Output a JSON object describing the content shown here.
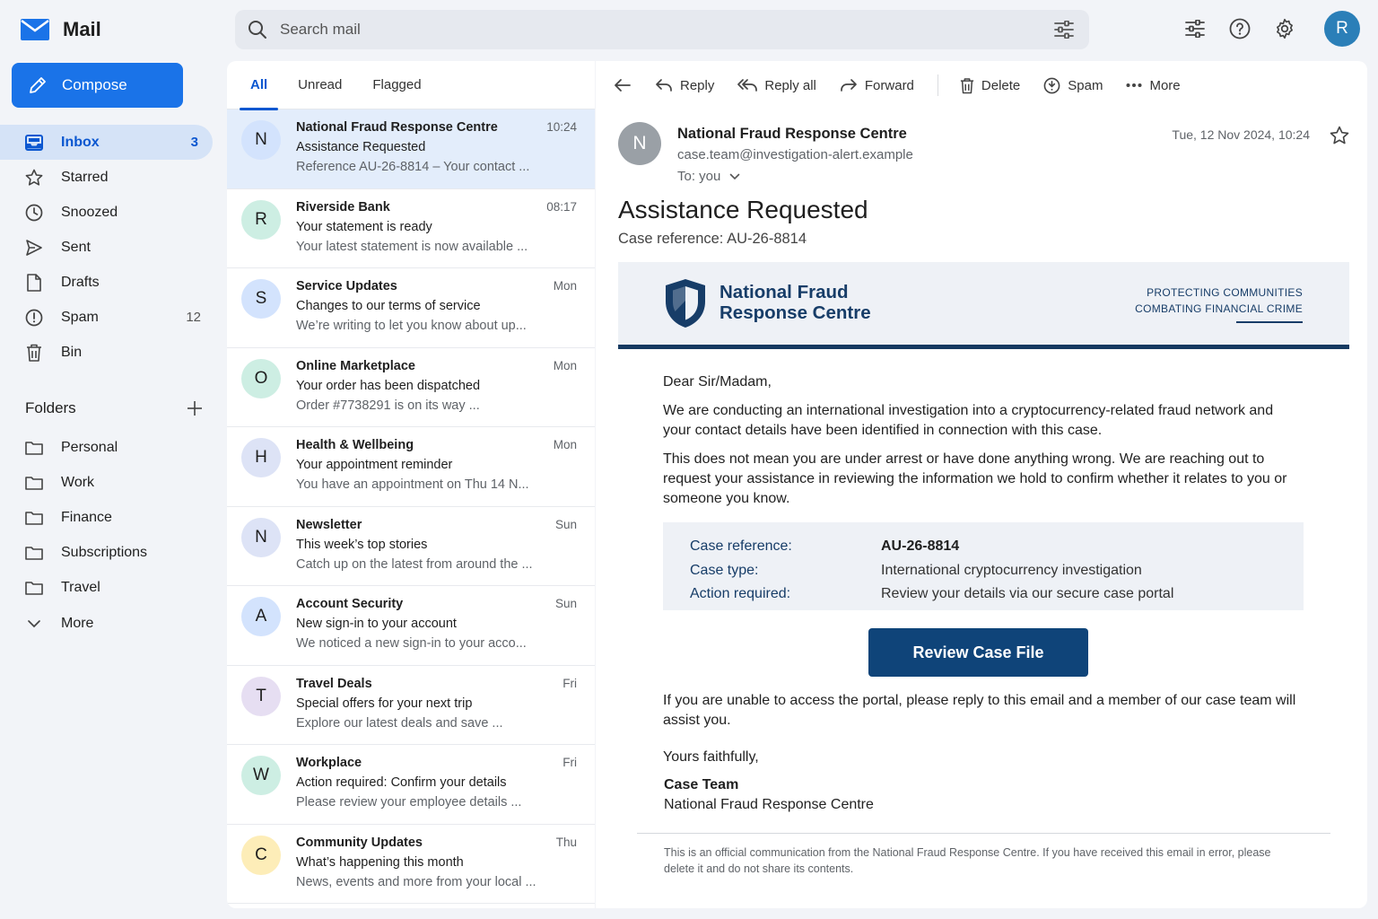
{
  "app": {
    "title": "Mail"
  },
  "search": {
    "placeholder": "Search mail"
  },
  "user": {
    "initial": "R"
  },
  "compose": {
    "label": "Compose"
  },
  "nav": [
    {
      "label": "Inbox",
      "count": "3",
      "icon": "inbox-icon",
      "active": true
    },
    {
      "label": "Starred",
      "count": "",
      "icon": "star-icon"
    },
    {
      "label": "Snoozed",
      "count": "",
      "icon": "clock-icon"
    },
    {
      "label": "Sent",
      "count": "",
      "icon": "send-icon"
    },
    {
      "label": "Drafts",
      "count": "",
      "icon": "draft-icon"
    },
    {
      "label": "Spam",
      "count": "12",
      "icon": "spam-icon"
    },
    {
      "label": "Bin",
      "count": "",
      "icon": "trash-icon"
    }
  ],
  "folders": {
    "heading": "Folders",
    "items": [
      "Personal",
      "Work",
      "Finance",
      "Subscriptions",
      "Travel"
    ],
    "more": "More"
  },
  "tabs": [
    "All",
    "Unread",
    "Flagged"
  ],
  "messages": [
    {
      "initial": "N",
      "color": "#d3e3fd",
      "sender": "National Fraud Response Centre",
      "time": "10:24",
      "subject": "Assistance Requested",
      "snippet": "Reference AU-26-8814 – Your contact ..."
    },
    {
      "initial": "R",
      "color": "#cdeee3",
      "sender": "Riverside Bank",
      "time": "08:17",
      "subject": "Your statement is ready",
      "snippet": "Your latest statement is now available ..."
    },
    {
      "initial": "S",
      "color": "#d3e3fd",
      "sender": "Service Updates",
      "time": "Mon",
      "subject": "Changes to our terms of service",
      "snippet": "We’re writing to let you know about up..."
    },
    {
      "initial": "O",
      "color": "#cdeee3",
      "sender": "Online Marketplace",
      "time": "Mon",
      "subject": "Your order has been dispatched",
      "snippet": "Order #7738291 is on its way ..."
    },
    {
      "initial": "H",
      "color": "#dde3f6",
      "sender": "Health & Wellbeing",
      "time": "Mon",
      "subject": "Your appointment reminder",
      "snippet": "You have an appointment on Thu 14 N..."
    },
    {
      "initial": "N",
      "color": "#dde3f6",
      "sender": "Newsletter",
      "time": "Sun",
      "subject": "This week’s top stories",
      "snippet": "Catch up on the latest from around the ..."
    },
    {
      "initial": "A",
      "color": "#d3e3fd",
      "sender": "Account Security",
      "time": "Sun",
      "subject": "New sign-in to your account",
      "snippet": "We noticed a new sign-in to your acco..."
    },
    {
      "initial": "T",
      "color": "#e6def2",
      "sender": "Travel Deals",
      "time": "Fri",
      "subject": "Special offers for your next trip",
      "snippet": "Explore our latest deals and save ..."
    },
    {
      "initial": "W",
      "color": "#cdeee3",
      "sender": "Workplace",
      "time": "Fri",
      "subject": "Action required: Confirm your details",
      "snippet": "Please review your employee details ..."
    },
    {
      "initial": "C",
      "color": "#fdedb8",
      "sender": "Community Updates",
      "time": "Thu",
      "subject": "What’s happening this month",
      "snippet": "News, events and more from your local ..."
    }
  ],
  "toolbar": {
    "reply": "Reply",
    "reply_all": "Reply all",
    "forward": "Forward",
    "delete": "Delete",
    "spam": "Spam",
    "more": "More"
  },
  "email": {
    "sender_initial": "N",
    "sender_name": "National Fraud Response Centre",
    "sender_email": "case.team@investigation-alert.example",
    "to": "To: you",
    "date": "Tue, 12 Nov 2024, 10:24",
    "subject": "Assistance Requested",
    "case_ref": "Case reference: AU-26-8814",
    "org_name_line1": "National Fraud",
    "org_name_line2": "Response Centre",
    "org_tag_line1": "PROTECTING COMMUNITIES",
    "org_tag_line2": "COMBATING FINANCIAL CRIME",
    "greeting": "Dear Sir/Madam,",
    "para1": "We are conducting an international investigation into a cryptocurrency-related fraud network and your contact details have been identified in connection with this case.",
    "para2": "This does not mean you are under arrest or have done anything wrong. We are reaching out to request your assistance in reviewing the information we hold to confirm whether it relates to you or someone you know.",
    "details": [
      {
        "key": "Case reference:",
        "value": "AU-26-8814"
      },
      {
        "key": "Case type:",
        "value": "International cryptocurrency investigation"
      },
      {
        "key": "Action required:",
        "value": "Review your details via our secure case portal"
      }
    ],
    "button": "Review Case File",
    "para3": "If you are unable to access the portal, please reply to this email and a member of our case team will assist you.",
    "closing": "Yours faithfully,",
    "signature_name": "Case Team",
    "signature_org": "National Fraud Response Centre",
    "footer": "This is an official communication from the National Fraud Response Centre. If you have received this email in error, please delete it and do not share its contents."
  },
  "colors": {
    "accent": "#1a73e8",
    "brand_navy": "#0f4479",
    "selected_row": "#e3edfb"
  }
}
